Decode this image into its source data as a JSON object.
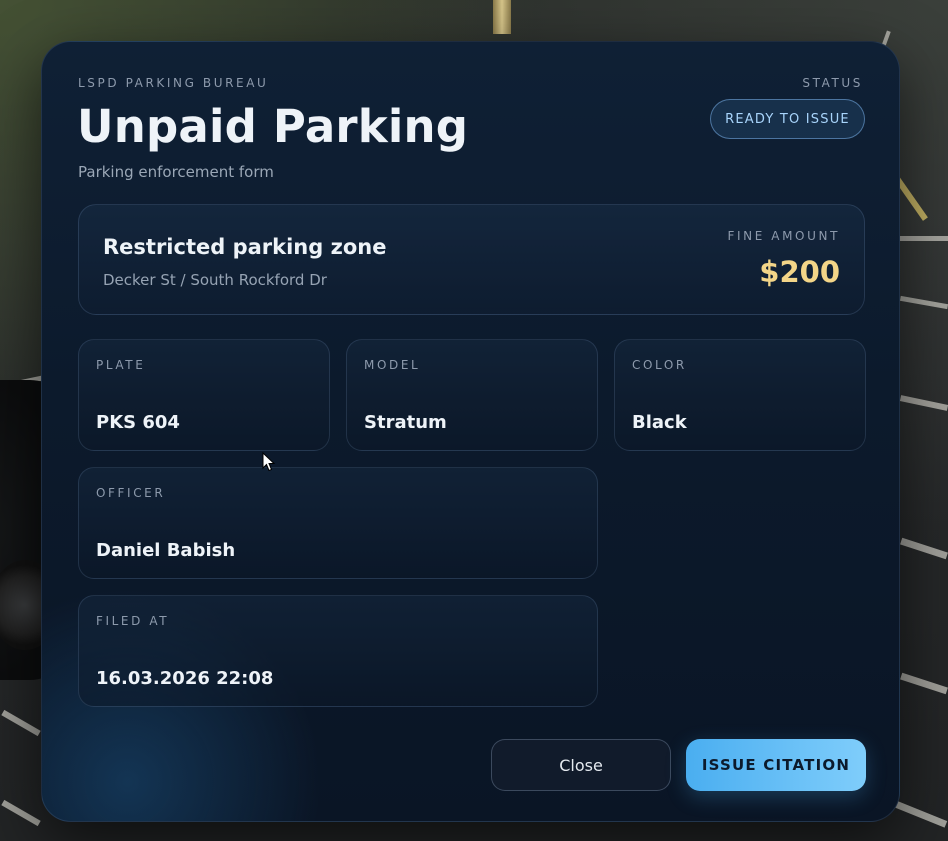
{
  "header": {
    "eyebrow": "LSPD PARKING BUREAU",
    "title": "Unpaid Parking",
    "subtitle": "Parking enforcement form",
    "status_label": "STATUS",
    "status_value": "READY TO ISSUE"
  },
  "summary": {
    "violation": "Restricted parking zone",
    "location": "Decker St / South Rockford Dr",
    "fine_label": "FINE AMOUNT",
    "fine_amount": "$200"
  },
  "fields": {
    "plate": {
      "label": "PLATE",
      "value": "PKS 604"
    },
    "model": {
      "label": "MODEL",
      "value": "Stratum"
    },
    "color": {
      "label": "COLOR",
      "value": "Black"
    },
    "officer": {
      "label": "OFFICER",
      "value": "Daniel Babish"
    },
    "filed_at": {
      "label": "FILED AT",
      "value": "16.03.2026 22:08"
    }
  },
  "buttons": {
    "close": "Close",
    "issue": "ISSUE CITATION"
  },
  "colors": {
    "accent": "#7fcdfb",
    "fine": "#f3d588",
    "panel": "#0c1a2c"
  },
  "icons": {
    "cursor": "mouse-pointer-icon"
  }
}
